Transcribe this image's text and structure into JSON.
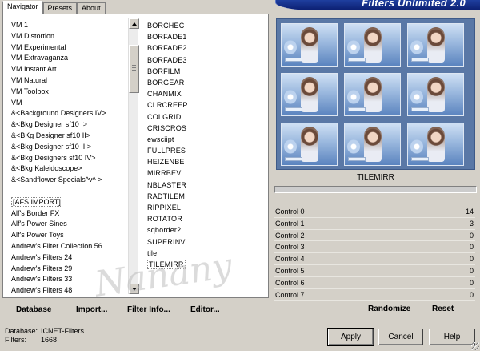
{
  "header": {
    "title": "Filters Unlimited 2.0"
  },
  "tabs": [
    {
      "label": "Navigator",
      "active": true
    },
    {
      "label": "Presets",
      "active": false
    },
    {
      "label": "About",
      "active": false
    }
  ],
  "categories": [
    "VM 1",
    "VM Distortion",
    "VM Experimental",
    "VM Extravaganza",
    "VM Instant Art",
    "VM Natural",
    "VM Toolbox",
    "VM",
    "&<Background Designers IV>",
    "&<Bkg Designer sf10 I>",
    "&<BKg Designer sf10 II>",
    "&<Bkg Designer sf10 III>",
    "&<Bkg Designers sf10 IV>",
    "&<Bkg Kaleidoscope>",
    "&<Sandflower Specials^v^ >",
    "",
    "[AFS IMPORT]",
    "Alf's Border FX",
    "Alf's Power Sines",
    "Alf's Power Toys",
    "Andrew's Filter Collection 56",
    "Andrew's Filters 24",
    "Andrew's Filters 29",
    "Andrew's Filters 33",
    "Andrew's Filters 48"
  ],
  "filters": [
    "BORCHEC",
    "BORFADE1",
    "BORFADE2",
    "BORFADE3",
    "BORFILM",
    "BORGEAR",
    "CHANMIX",
    "CLRCREEP",
    "COLGRID",
    "CRISCROS",
    "ewsciipt",
    "FULLPRES",
    "HEIZENBE",
    "MIRRBEVL",
    "NBLASTER",
    "RADTILEM",
    "RIPPIXEL",
    "ROTATOR",
    "sqborder2",
    "SUPERINV",
    "tile",
    "TILEMIRR"
  ],
  "selected_filter": "TILEMIRR",
  "list_buttons": {
    "database": "Database",
    "import": "Import...",
    "filter_info": "Filter Info...",
    "editor": "Editor..."
  },
  "controls": [
    {
      "label": "Control 0",
      "value": "14"
    },
    {
      "label": "Control 1",
      "value": "3"
    },
    {
      "label": "Control 2",
      "value": "0"
    },
    {
      "label": "Control 3",
      "value": "0"
    },
    {
      "label": "Control 4",
      "value": "0"
    },
    {
      "label": "Control 5",
      "value": "0"
    },
    {
      "label": "Control 6",
      "value": "0"
    },
    {
      "label": "Control 7",
      "value": "0"
    }
  ],
  "randomize_label": "Randomize",
  "reset_label": "Reset",
  "status": {
    "database_key": "Database:",
    "database_value": "ICNET-Filters",
    "filters_key": "Filters:",
    "filters_value": "1668"
  },
  "buttons": {
    "apply": "Apply",
    "cancel": "Cancel",
    "help": "Help"
  },
  "watermark": "Nanany"
}
